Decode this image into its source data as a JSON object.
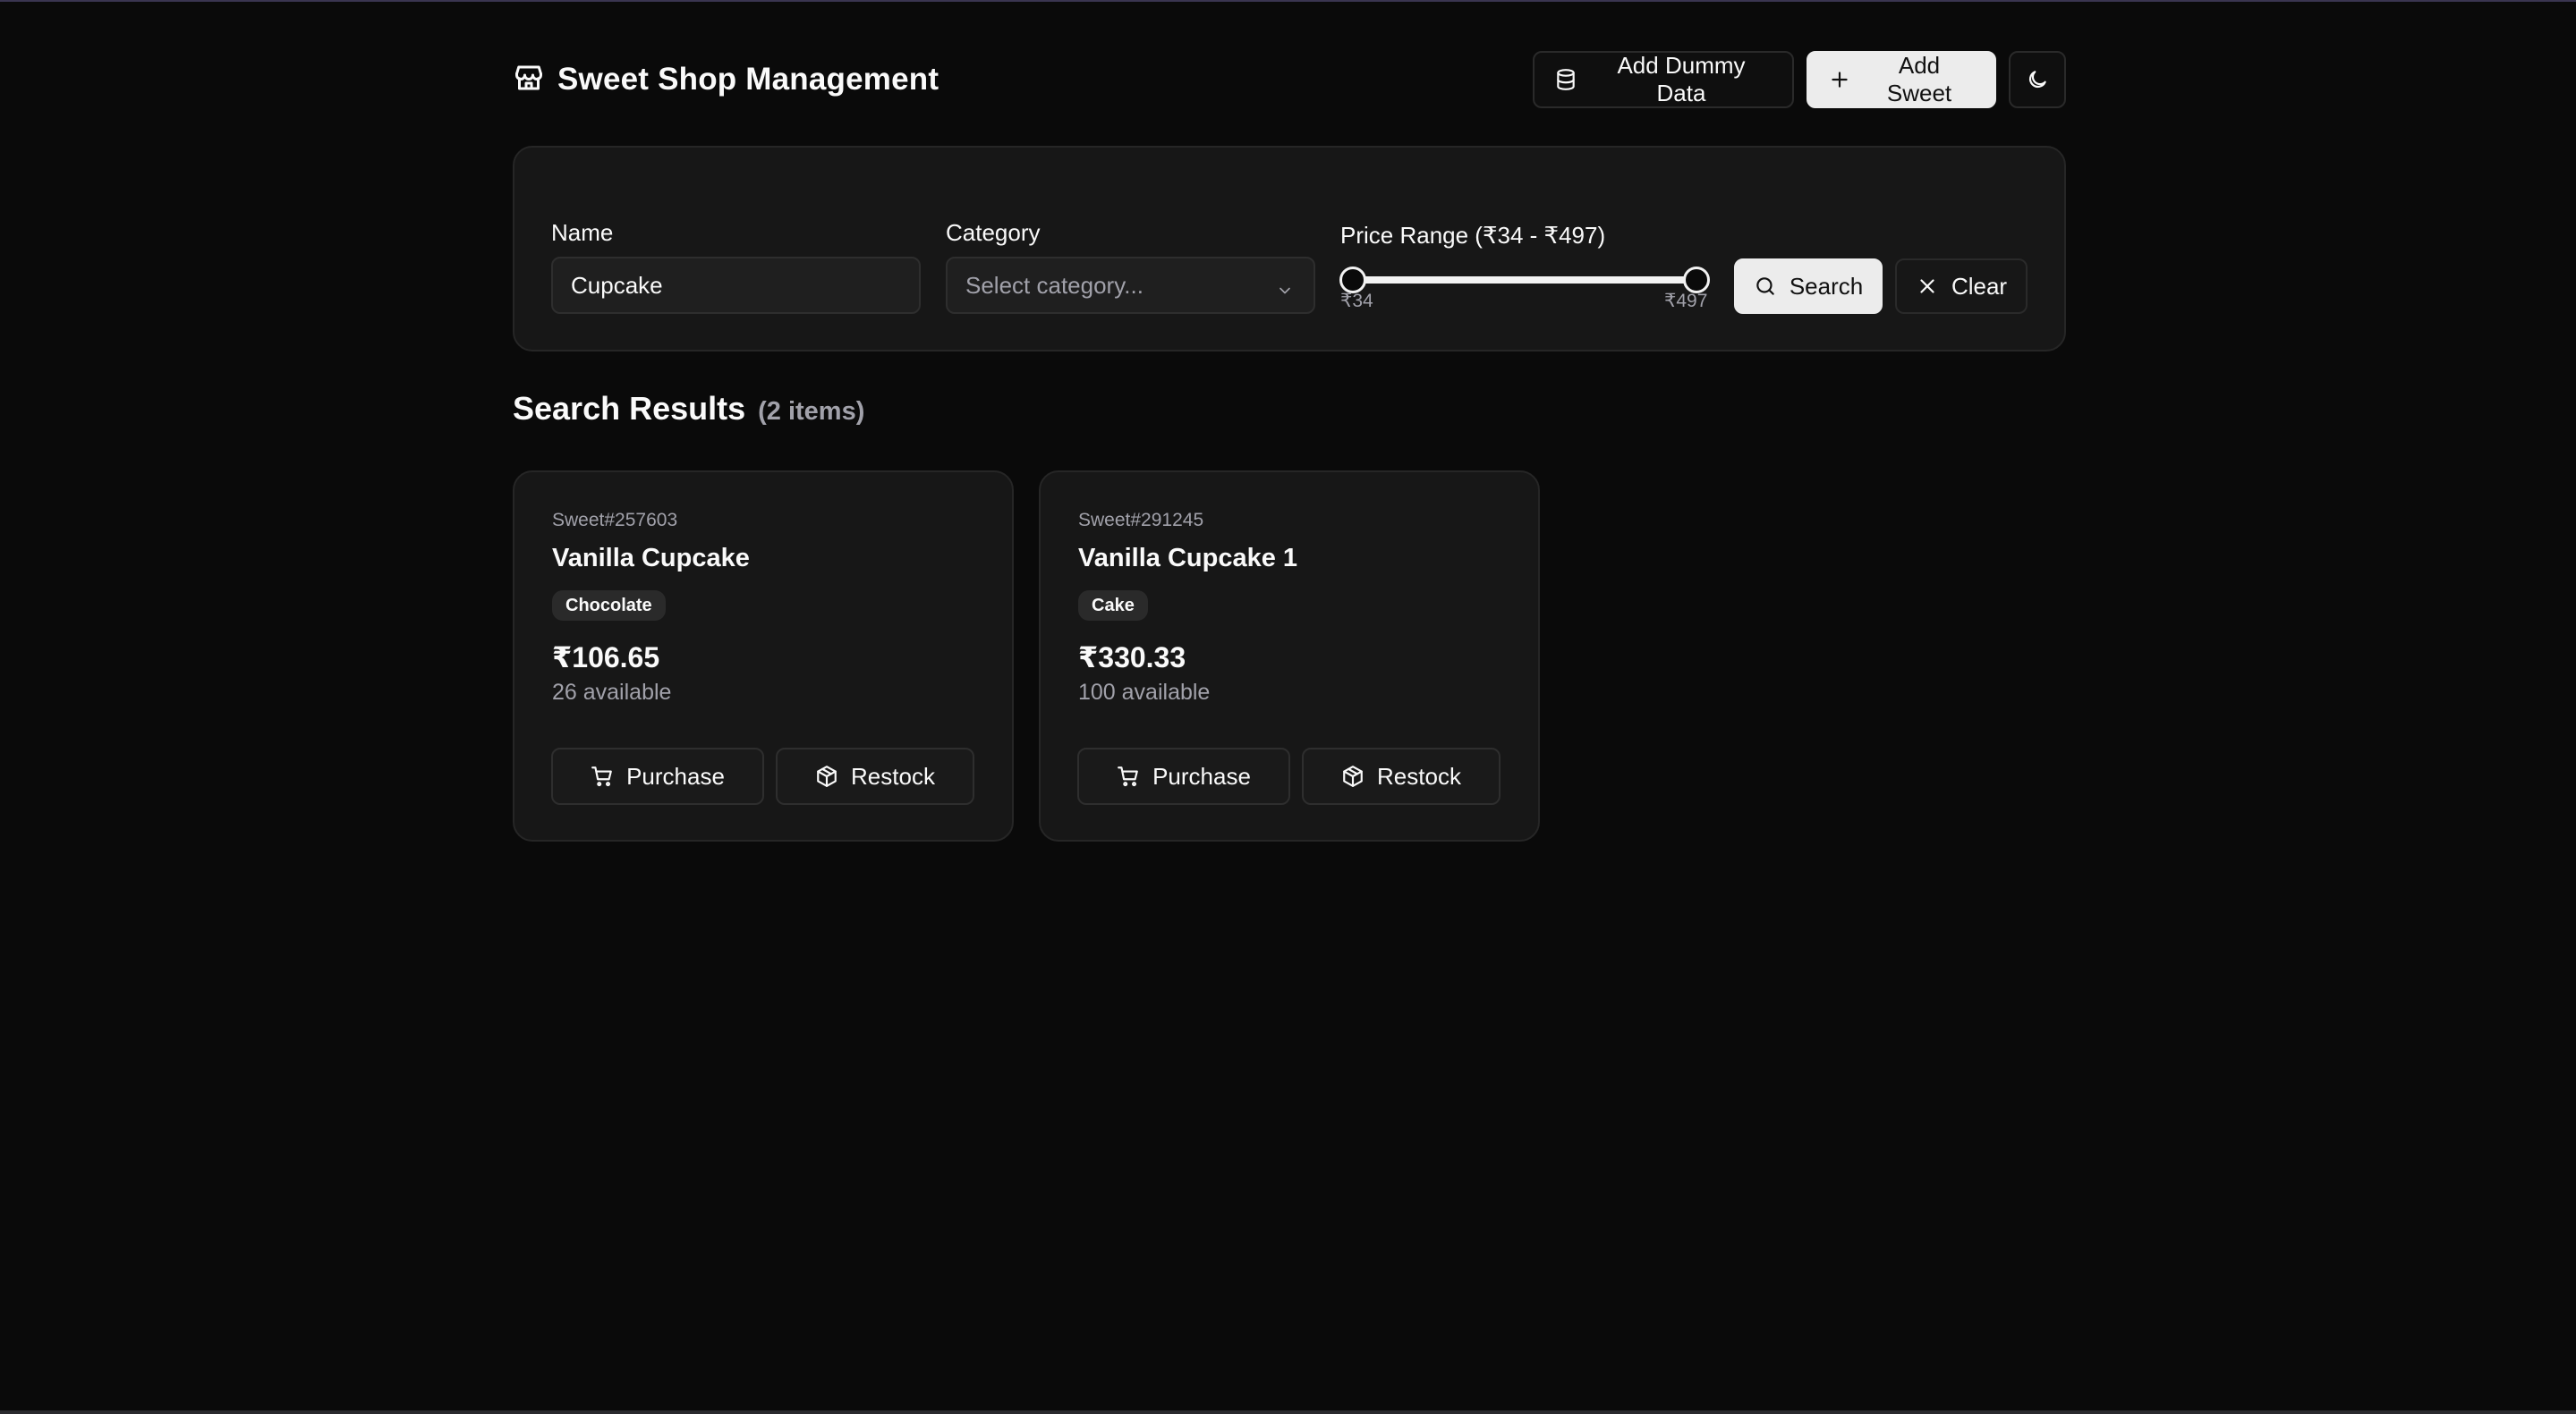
{
  "app": {
    "title": "Sweet Shop Management"
  },
  "header": {
    "add_dummy_label": "Add Dummy Data",
    "add_sweet_label": "Add Sweet",
    "theme_icon": "moon-icon"
  },
  "filters": {
    "name_label": "Name",
    "name_value": "Cupcake",
    "category_label": "Category",
    "category_placeholder": "Select category...",
    "price_label": "Price Range (₹34 - ₹497)",
    "price_min_label": "₹34",
    "price_max_label": "₹497",
    "price_range": {
      "min": 34,
      "max": 497,
      "selected_min": 34,
      "selected_max": 497
    },
    "search_label": "Search",
    "clear_label": "Clear"
  },
  "results": {
    "title": "Search Results",
    "count_label": "(2 items)",
    "items": [
      {
        "id": "Sweet#257603",
        "name": "Vanilla Cupcake",
        "category": "Chocolate",
        "price": "₹106.65",
        "stock": "26 available",
        "purchase_label": "Purchase",
        "restock_label": "Restock"
      },
      {
        "id": "Sweet#291245",
        "name": "Vanilla Cupcake 1",
        "category": "Cake",
        "price": "₹330.33",
        "stock": "100 available",
        "purchase_label": "Purchase",
        "restock_label": "Restock"
      }
    ]
  },
  "colors": {
    "background": "#0a0a0a",
    "card": "#171717",
    "border": "#262626",
    "muted_text": "#a1a1aa",
    "primary_button": "#ececec"
  }
}
